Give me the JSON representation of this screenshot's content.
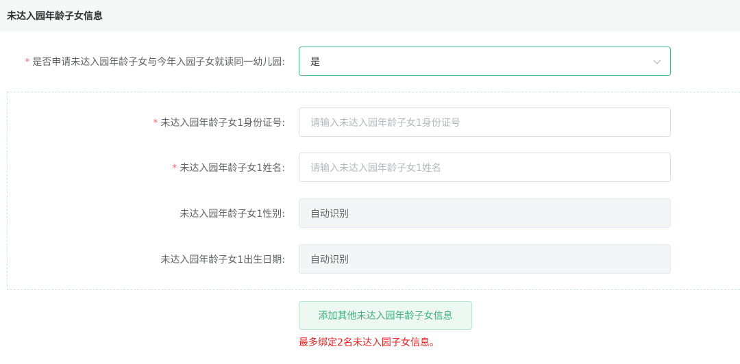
{
  "section": {
    "title": "未达入园年龄子女信息"
  },
  "same_kindergarten": {
    "required_mark": "*",
    "label": "是否申请未达入园年龄子女与今年入园子女就读同一幼儿园:",
    "value": "是"
  },
  "child1": {
    "id_number": {
      "required_mark": "*",
      "label": "未达入园年龄子女1身份证号:",
      "placeholder": "请输入未达入园年龄子女1身份证号"
    },
    "name": {
      "required_mark": "*",
      "label": "未达入园年龄子女1姓名:",
      "placeholder": "请输入未达入园年龄子女1姓名"
    },
    "gender": {
      "label": "未达入园年龄子女1性别:",
      "value": "自动识别"
    },
    "birth_date": {
      "label": "未达入园年龄子女1出生日期:",
      "value": "自动识别"
    }
  },
  "actions": {
    "add_label": "添加其他未达入园年龄子女信息",
    "limit_note": "最多绑定2名未达入园子女信息。"
  },
  "colors": {
    "accent": "#3fb07c",
    "required": "#f56c6c",
    "warning": "#f51e1e"
  },
  "icons": {
    "select_arrow": "chevron-down-icon"
  }
}
